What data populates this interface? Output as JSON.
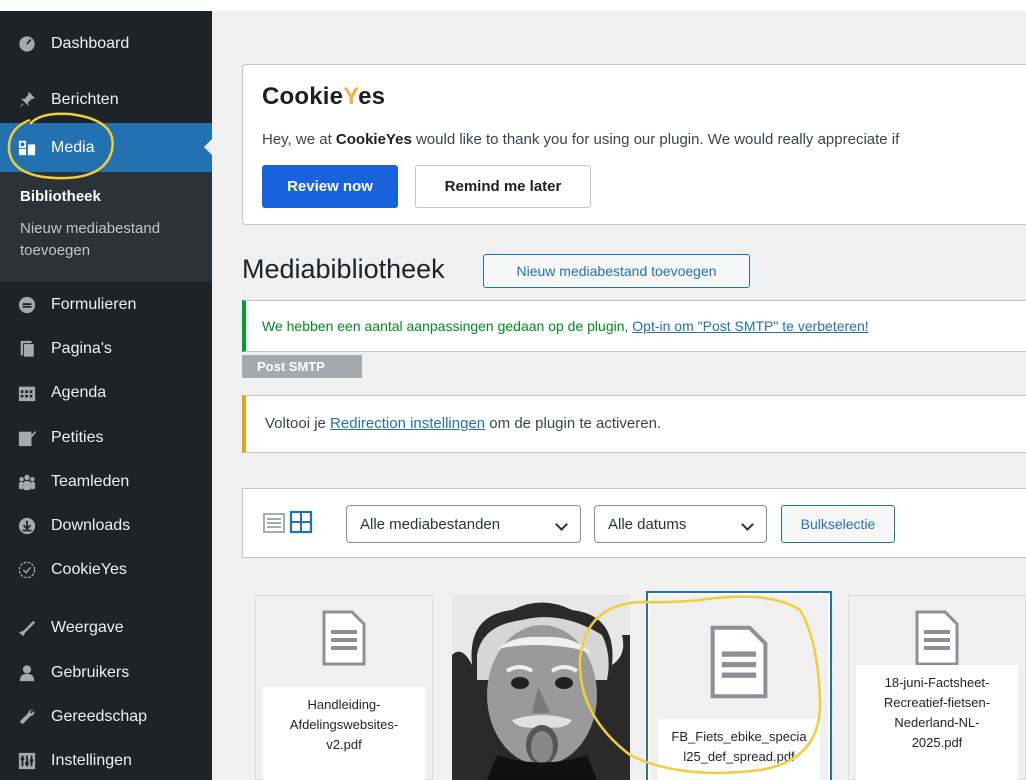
{
  "sidebar": {
    "items": [
      {
        "label": "Dashboard",
        "icon": "dashboard-icon"
      },
      {
        "label": "Berichten",
        "icon": "pin-icon"
      },
      {
        "label": "Media",
        "icon": "media-icon"
      },
      {
        "label": "Formulieren",
        "icon": "forms-icon"
      },
      {
        "label": "Pagina's",
        "icon": "pages-icon"
      },
      {
        "label": "Agenda",
        "icon": "calendar-icon"
      },
      {
        "label": "Petities",
        "icon": "edit-icon"
      },
      {
        "label": "Teamleden",
        "icon": "team-icon"
      },
      {
        "label": "Downloads",
        "icon": "download-icon"
      },
      {
        "label": "CookieYes",
        "icon": "cookieyes-icon"
      },
      {
        "label": "Weergave",
        "icon": "appearance-icon"
      },
      {
        "label": "Gebruikers",
        "icon": "users-icon"
      },
      {
        "label": "Gereedschap",
        "icon": "tools-icon"
      },
      {
        "label": "Instellingen",
        "icon": "settings-icon"
      }
    ],
    "submenu": {
      "current": "Bibliotheek",
      "add_new_line1": "Nieuw mediabestand",
      "add_new_line2": "toevoegen"
    }
  },
  "cookie_notice": {
    "logo_part1": "Cookie",
    "logo_part2": "Y",
    "logo_part3": "es",
    "text_before": "Hey, we at ",
    "text_bold": "CookieYes",
    "text_after": " would like to thank you for using our plugin. We would really appreciate if",
    "review_button": "Review now",
    "remind_button": "Remind me later"
  },
  "page": {
    "title": "Mediabibliotheek",
    "add_new_button": "Nieuw mediabestand toevoegen"
  },
  "smtp_notice": {
    "text": "We hebben een aantal aanpassingen gedaan op de plugin, ",
    "link": "Opt-in om \"Post SMTP\" te verbeteren!",
    "badge": "Post SMTP"
  },
  "redirection_notice": {
    "text_before": "Voltooi je ",
    "link": "Redirection instellingen",
    "text_after": " om de plugin te activeren."
  },
  "toolbar": {
    "type_filter": "Alle mediabestanden",
    "date_filter": "Alle datums",
    "bulk_button": "Bulkselectie"
  },
  "media": [
    {
      "name_l1": "Handleiding-",
      "name_l2": "Afdelingswebsites-",
      "name_l3": "v2.pdf"
    },
    {
      "name_l1": "",
      "name_l2": "",
      "name_l3": ""
    },
    {
      "name_l1": "FB_Fiets_ebike_specia",
      "name_l2": "l25_def_spread.pdf",
      "name_l3": ""
    },
    {
      "name_l1": "18-juni-Factsheet-",
      "name_l2": "Recreatief-fietsen-",
      "name_l3": "Nederland-NL-",
      "name_l4": "2025.pdf"
    }
  ],
  "colors": {
    "sidebar_bg": "#1d2327",
    "active_bg": "#2271b1",
    "annotation": "#f2cd3a",
    "cookieyes_blue": "#1863dc"
  }
}
